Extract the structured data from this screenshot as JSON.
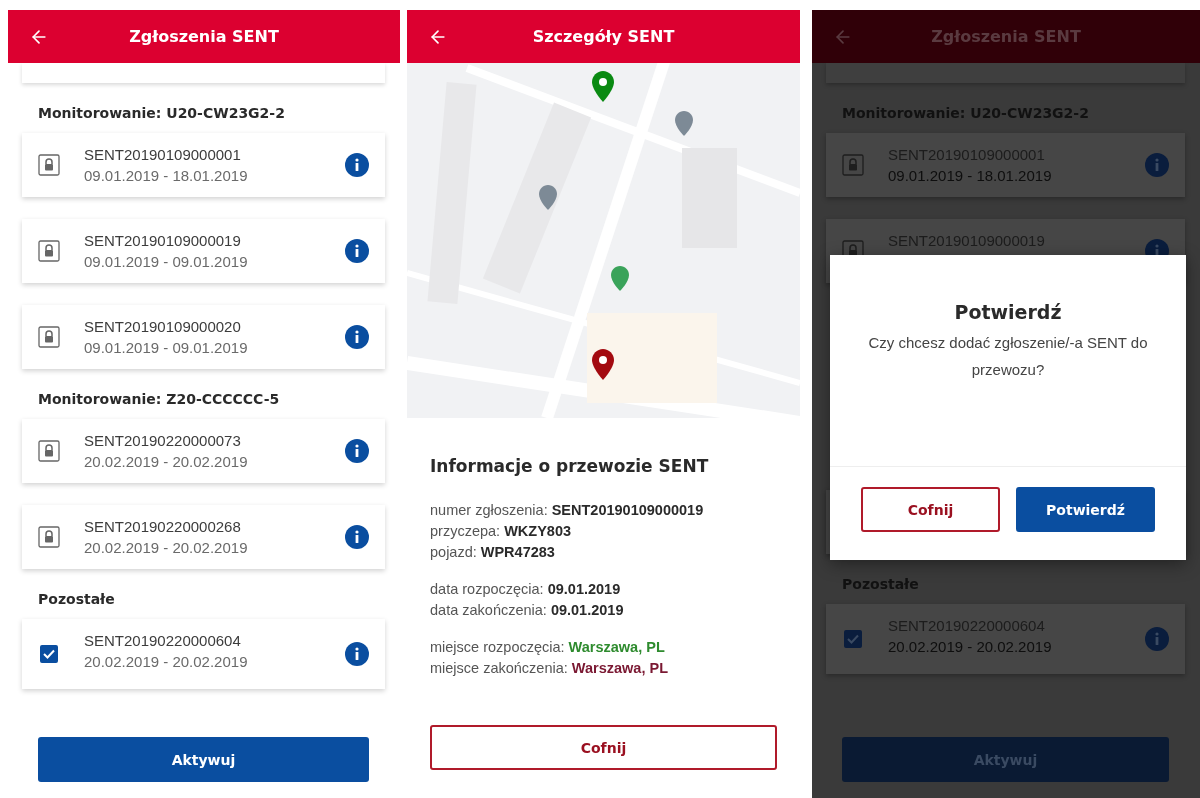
{
  "list_screen": {
    "title": "Zgłoszenia SENT",
    "sections": [
      {
        "title": "Monitorowanie: U20-CW23G2-2",
        "items": [
          {
            "kind": "locked",
            "code": "SENT20190109000001",
            "dates": "09.01.2019 - 18.01.2019"
          },
          {
            "kind": "locked",
            "code": "SENT20190109000019",
            "dates": "09.01.2019 - 09.01.2019"
          },
          {
            "kind": "locked",
            "code": "SENT20190109000020",
            "dates": "09.01.2019 - 09.01.2019"
          }
        ]
      },
      {
        "title": "Monitorowanie: Z20-CCCCCC-5",
        "items": [
          {
            "kind": "locked",
            "code": "SENT20190220000073",
            "dates": "20.02.2019 - 20.02.2019"
          },
          {
            "kind": "locked",
            "code": "SENT20190220000268",
            "dates": "20.02.2019 - 20.02.2019"
          }
        ]
      },
      {
        "title": "Pozostałe",
        "items": [
          {
            "kind": "checkbox",
            "checked": true,
            "code": "SENT20190220000604",
            "dates": "20.02.2019 - 20.02.2019"
          }
        ]
      }
    ],
    "button": "Aktywuj"
  },
  "details_screen": {
    "title": "Szczegóły SENT",
    "info_title": "Informacje o przewozie SENT",
    "groups": [
      [
        {
          "label": "numer zgłoszenia:",
          "value": "SENT20190109000019"
        },
        {
          "label": "przyczepa:",
          "value": "WKZY803"
        },
        {
          "label": "pojazd:",
          "value": "WPR47283"
        }
      ],
      [
        {
          "label": "data rozpoczęcia:",
          "value": "09.01.2019"
        },
        {
          "label": "data zakończenia:",
          "value": "09.01.2019"
        }
      ],
      [
        {
          "label": "miejsce rozpoczęcia:",
          "value": "Warszawa, PL",
          "color": "#2e8b2e"
        },
        {
          "label": "miejsce zakończenia:",
          "value": "Warszawa, PL",
          "color": "#7a1832"
        }
      ]
    ],
    "button": "Cofnij"
  },
  "dialog_screen": {
    "title": "Zgłoszenia SENT",
    "top_section": {
      "title": "Monitorowanie: U20-CW23G2-2",
      "items": [
        {
          "kind": "locked",
          "code": "SENT20190109000001",
          "dates": "09.01.2019 - 18.01.2019"
        },
        {
          "kind": "locked",
          "code": "SENT20190109000019"
        }
      ]
    },
    "bottom_section": {
      "title": "Pozostałe",
      "items": [
        {
          "kind": "checkbox",
          "checked": true,
          "code": "SENT20190220000604",
          "dates": "20.02.2019 - 20.02.2019"
        }
      ]
    },
    "button": "Aktywuj",
    "dialog": {
      "title": "Potwierdź",
      "message": "Czy chcesz dodać zgłoszenie/-a SENT do przewozu?",
      "buttons": [
        {
          "kind": "secondary",
          "label": "Cofnij"
        },
        {
          "kind": "primary",
          "label": "Potwierdź"
        }
      ]
    }
  }
}
